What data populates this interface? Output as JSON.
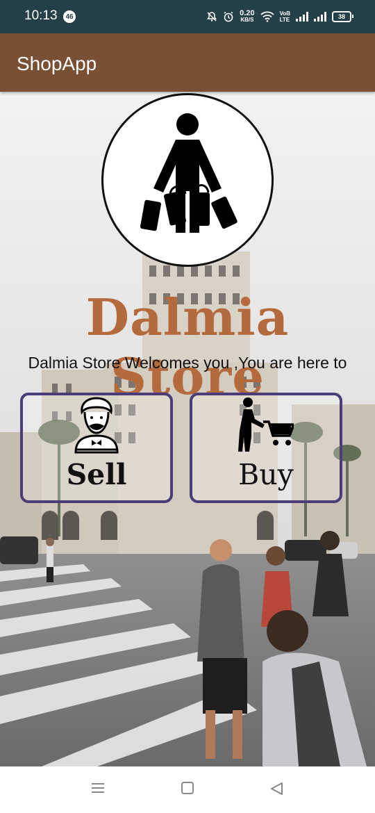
{
  "status_bar": {
    "time": "10:13",
    "notification_badge": "46",
    "speed_value": "0.20",
    "speed_unit": "KB/S",
    "volte_top": "VoB",
    "volte_bottom": "LTE",
    "battery": "38"
  },
  "app_bar": {
    "title": "ShopApp"
  },
  "main": {
    "store_title": "Dalmia Store",
    "welcome_text": "Dalmia Store Welcomes you ,You are here to",
    "sell_label": "Sell",
    "buy_label": "Buy"
  },
  "colors": {
    "status_bar": "#234049",
    "app_bar": "#7a5034",
    "title_accent": "#b46a3c",
    "card_border": "#4a3d78"
  },
  "icons": {
    "logo": "shopper-bags-icon",
    "sell": "seller-man-icon",
    "buy": "cart-push-icon"
  }
}
